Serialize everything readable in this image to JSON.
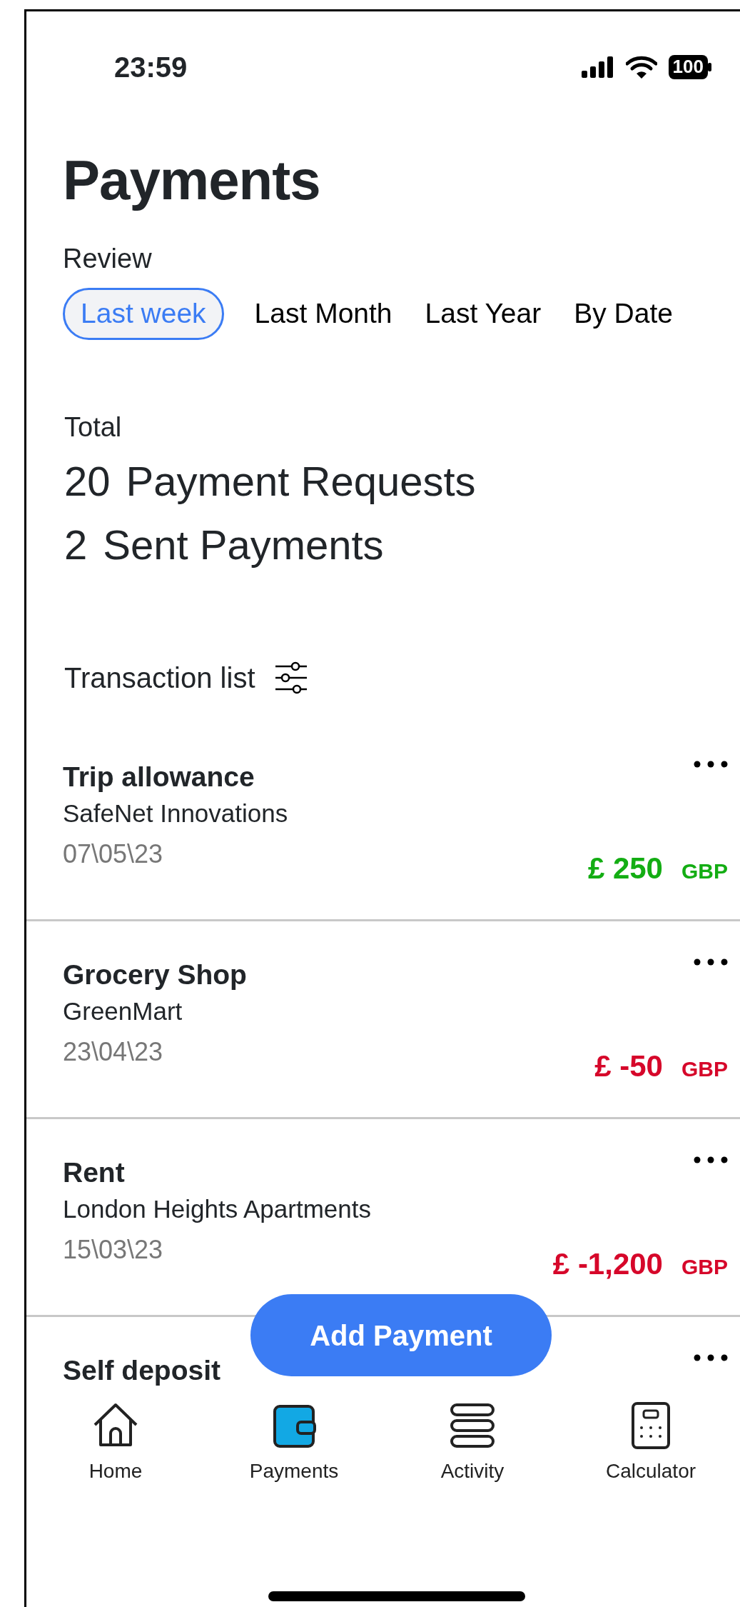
{
  "status_bar": {
    "time": "23:59",
    "battery": "100"
  },
  "title": "Payments",
  "review": {
    "label": "Review",
    "tabs": [
      {
        "label": "Last week",
        "selected": true
      },
      {
        "label": "Last Month",
        "selected": false
      },
      {
        "label": "Last Year",
        "selected": false
      },
      {
        "label": "By Date",
        "selected": false
      }
    ]
  },
  "totals": {
    "label": "Total",
    "lines": [
      {
        "count": "20",
        "label": "Payment Requests"
      },
      {
        "count": "2",
        "label": "Sent Payments"
      }
    ]
  },
  "transactions": {
    "header": "Transaction list",
    "rows": [
      {
        "title": "Trip allowance",
        "payee": "SafeNet Innovations",
        "date": "07\\05\\23",
        "amount": "£ 250",
        "currency": "GBP",
        "kind": "credit"
      },
      {
        "title": "Grocery Shop",
        "payee": "GreenMart",
        "date": "23\\04\\23",
        "amount": "£ -50",
        "currency": "GBP",
        "kind": "debit"
      },
      {
        "title": "Rent",
        "payee": "London Heights Apartments",
        "date": "15\\03\\23",
        "amount": "£ -1,200",
        "currency": "GBP",
        "kind": "debit"
      },
      {
        "title": "Self deposit"
      }
    ]
  },
  "add_button": "Add Payment",
  "nav": [
    {
      "label": "Home",
      "selected": false
    },
    {
      "label": "Payments",
      "selected": true
    },
    {
      "label": "Activity",
      "selected": false
    },
    {
      "label": "Calculator",
      "selected": false
    }
  ]
}
